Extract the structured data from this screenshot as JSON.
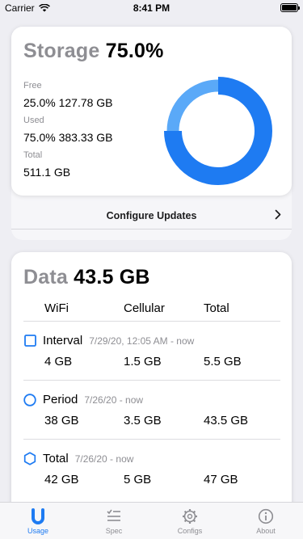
{
  "status": {
    "carrier": "Carrier",
    "time": "8:41 PM"
  },
  "storage": {
    "title_word": "Storage",
    "title_value": "75.0%",
    "free_label": "Free",
    "free_value": "25.0% 127.78 GB",
    "used_label": "Used",
    "used_value": "75.0% 383.33 GB",
    "total_label": "Total",
    "total_value": "511.1 GB",
    "used_fraction": 0.75,
    "used_color": "#1e7bf2",
    "free_color": "#5aa9f8"
  },
  "configure": {
    "label": "Configure Updates"
  },
  "data": {
    "title_word": "Data",
    "title_value": "43.5 GB",
    "columns": [
      "WiFi",
      "Cellular",
      "Total"
    ],
    "periods": [
      {
        "name": "Interval",
        "date": "7/29/20, 12:05 AM - now",
        "icon": "square-icon",
        "values": [
          "4 GB",
          "1.5 GB",
          "5.5 GB"
        ]
      },
      {
        "name": "Period",
        "date": "7/26/20 - now",
        "icon": "circle-icon",
        "values": [
          "38 GB",
          "3.5 GB",
          "43.5 GB"
        ]
      },
      {
        "name": "Total",
        "date": "7/26/20 - now",
        "icon": "hexagon-icon",
        "values": [
          "42 GB",
          "5 GB",
          "47 GB"
        ]
      }
    ],
    "accent": "#1e7bf2"
  },
  "tabs": [
    {
      "label": "Usage",
      "icon": "usage-icon",
      "active": true
    },
    {
      "label": "Spec",
      "icon": "spec-list-icon",
      "active": false
    },
    {
      "label": "Configs",
      "icon": "gear-icon",
      "active": false
    },
    {
      "label": "About",
      "icon": "info-icon",
      "active": false
    }
  ]
}
